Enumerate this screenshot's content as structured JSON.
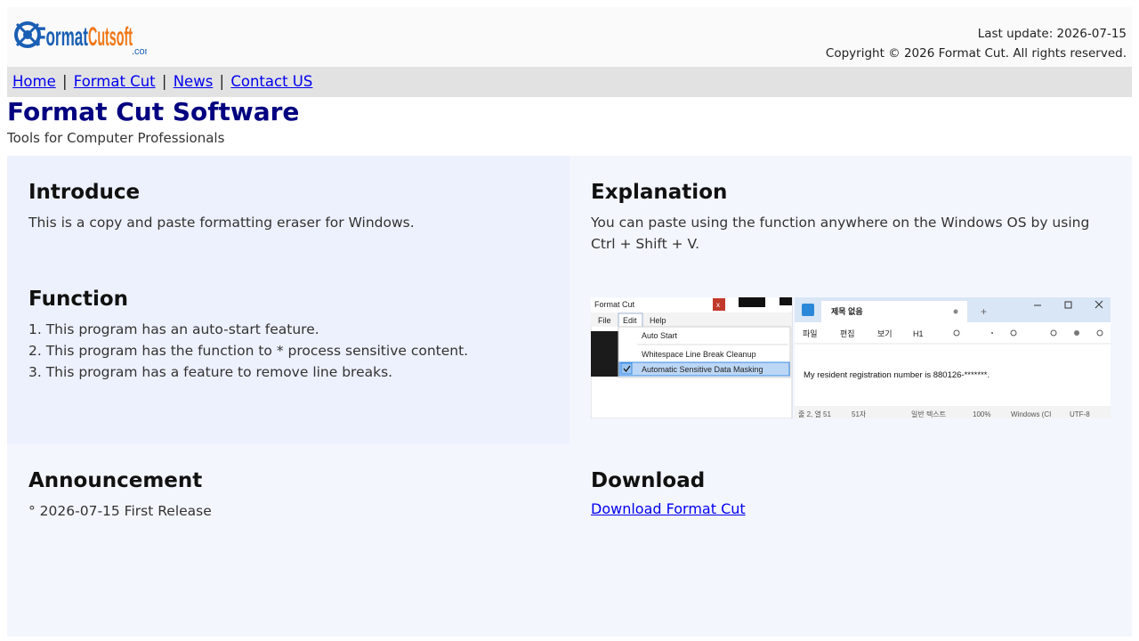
{
  "header": {
    "logo_text": "FormatCutsoft.com",
    "last_update": "Last update: 2026-07-15",
    "copyright": "Copyright © 2026 Format Cut. All rights reserved."
  },
  "nav": {
    "items": [
      "Home",
      "Format Cut",
      "News",
      "Contact US"
    ],
    "separator": "|"
  },
  "site": {
    "title": "Format Cut Software",
    "subtitle": "Tools for Computer Professionals"
  },
  "introduce": {
    "heading": "Introduce",
    "text": "This is a copy and paste formatting eraser for Windows."
  },
  "explanation": {
    "heading": "Explanation",
    "text": "You can paste using the function anywhere on the Windows OS by using Ctrl + Shift + V."
  },
  "function": {
    "heading": "Function",
    "items": [
      "1. This program has an auto-start feature.",
      "2. This program has the function to * process sensitive content.",
      "3. This program has a feature to remove line breaks."
    ]
  },
  "screenshot": {
    "app_title": "Format Cut",
    "close": "x",
    "menu": [
      "File",
      "Edit",
      "Help"
    ],
    "dropdown": [
      "Auto Start",
      "Whitespace  Line Break Cleanup",
      "Automatic Sensitive Data Masking"
    ],
    "notepad_tab": "제목 없음",
    "notepad_menu": [
      "파일",
      "편집",
      "보기",
      "H1"
    ],
    "notepad_text": "My resident registration number is 880126-*******.",
    "status": [
      "줄 2, 열 51",
      "51자",
      "일반 텍스트",
      "100%",
      "Windows (CI",
      "UTF-8"
    ],
    "accent": "#7fb7f0"
  },
  "announcement": {
    "heading": "Announcement",
    "item": "° 2026-07-15 First Release"
  },
  "download": {
    "heading": "Download",
    "link": "Download Format Cut"
  },
  "colors": {
    "title": "#000080",
    "link": "#0000ee",
    "nav_bg": "#e2e2e2",
    "panel_a": "#edf1fd",
    "panel_b": "#f4f6fe",
    "logo_blue": "#1a5fb4",
    "logo_orange": "#f07818"
  }
}
